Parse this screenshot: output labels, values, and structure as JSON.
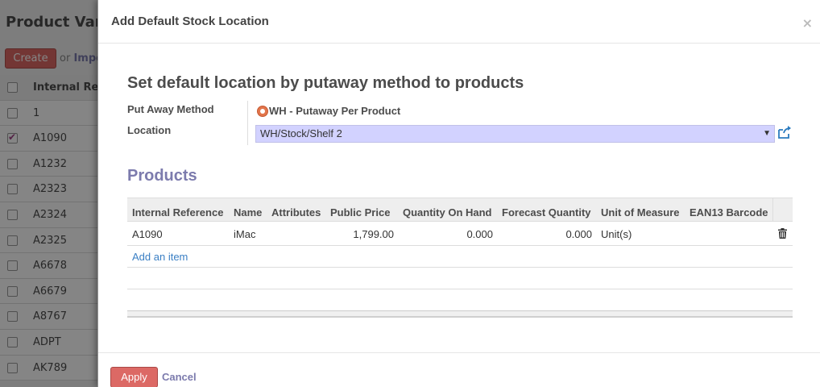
{
  "background": {
    "title": "Product Varia",
    "create_label": "Create",
    "or_text": "or",
    "import_label": "Impo",
    "column_header": "Internal Refer",
    "rows": [
      {
        "ref": "1",
        "checked": false
      },
      {
        "ref": "A1090",
        "checked": true
      },
      {
        "ref": "A1232",
        "checked": false
      },
      {
        "ref": "A2323",
        "checked": false
      },
      {
        "ref": "A2324",
        "checked": false
      },
      {
        "ref": "A2325",
        "checked": false
      },
      {
        "ref": "A6678",
        "checked": false
      },
      {
        "ref": "A6679",
        "checked": false
      },
      {
        "ref": "A8767",
        "checked": false
      },
      {
        "ref": "ADPT",
        "checked": false
      },
      {
        "ref": "AK789",
        "checked": false
      }
    ]
  },
  "modal": {
    "title": "Add Default Stock Location",
    "close_label": "×",
    "heading": "Set default location by putaway method to products",
    "put_away_label": "Put Away Method",
    "put_away_value": "WH - Putaway Per Product",
    "location_label": "Location",
    "location_value": "WH/Stock/Shelf 2",
    "products_heading": "Products",
    "columns": [
      "Internal Reference",
      "Name",
      "Attributes",
      "Public Price",
      "Quantity On Hand",
      "Forecast Quantity",
      "Unit of Measure",
      "EAN13 Barcode"
    ],
    "rows": [
      {
        "internal_reference": "A1090",
        "name": "iMac",
        "attributes": "",
        "public_price": "1,799.00",
        "qty_on_hand": "0.000",
        "forecast_qty": "0.000",
        "uom": "Unit(s)",
        "ean13": ""
      }
    ],
    "add_item_label": "Add an item",
    "apply_label": "Apply",
    "cancel_label": "Cancel"
  },
  "colors": {
    "accent_red": "#dc6965",
    "accent_purple": "#7c7bad",
    "link_blue": "#3a7fc4",
    "select_bg": "#d2d2ff"
  }
}
